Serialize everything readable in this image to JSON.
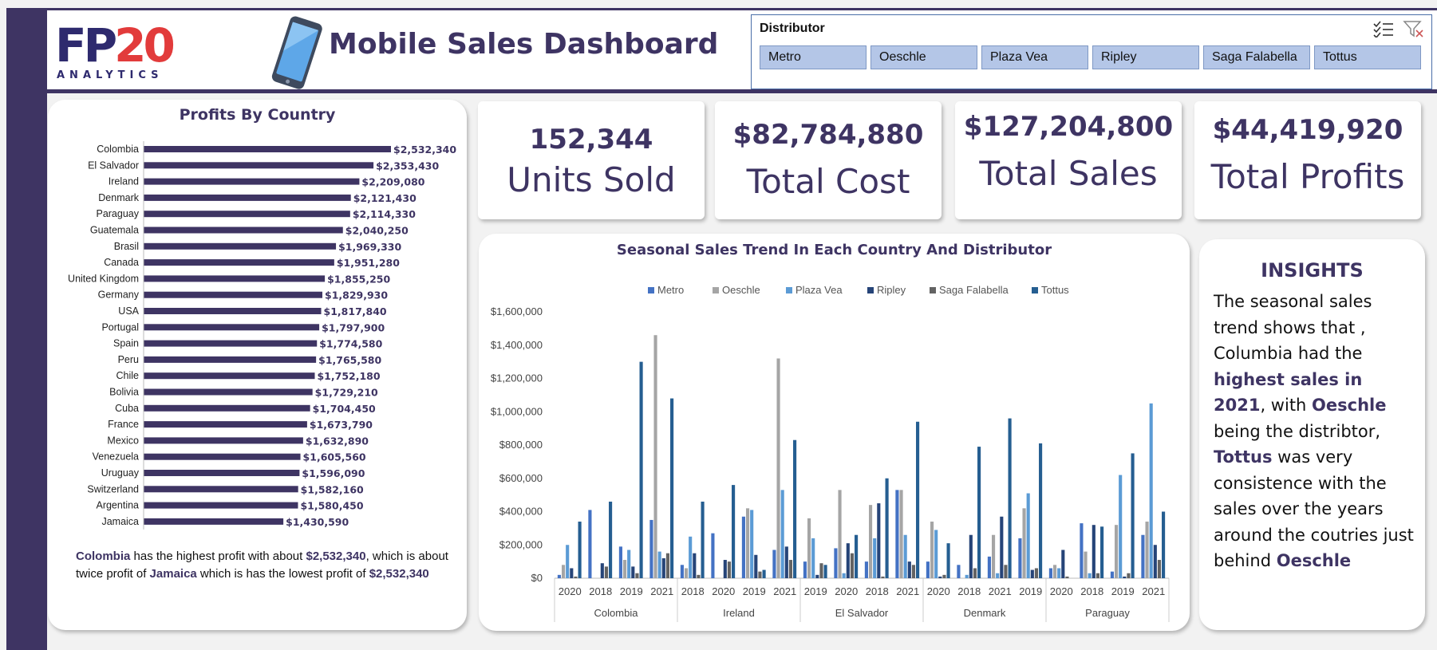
{
  "header": {
    "logo_main_a": "FP",
    "logo_main_b": "20",
    "logo_sub": "ANALYTICS",
    "title": "Mobile Sales Dashboard"
  },
  "slicer": {
    "title": "Distributor",
    "items": [
      "Metro",
      "Oeschle",
      "Plaza Vea",
      "Ripley",
      "Saga Falabella",
      "Tottus"
    ],
    "multi_select_icon": "multi-select-icon",
    "clear_filter_icon": "clear-filter-icon"
  },
  "kpis": [
    {
      "value": "152,344",
      "label": "Units Sold"
    },
    {
      "value": "$82,784,880",
      "label": "Total Cost"
    },
    {
      "value": "$127,204,800",
      "label": "Total Sales"
    },
    {
      "value": "$44,419,920",
      "label": "Total Profits"
    }
  ],
  "profits": {
    "note": {
      "t1": "Colombia",
      "t2": " has the highest profit with about ",
      "t3": "$2,532,340",
      "t4": ", which is about twice profit of ",
      "t5": "Jamaica",
      "t6": " which is has the lowest profit of ",
      "t7": "$2,532,340"
    }
  },
  "insights": {
    "title": "INSIGHTS",
    "t1": "The seasonal sales trend shows that , Columbia had the ",
    "t2": "highest sales in 2021",
    "t3": ", with ",
    "t4": "Oeschle",
    "t5": " being the distribtor, ",
    "t6": "Tottus",
    "t7": " was very consistence with the sales over the years around the coutries just behind ",
    "t8": "Oeschle"
  },
  "colors": {
    "accent": "#3e3463",
    "bar_profit": "#3e3463",
    "slicer_fill": "#b4c6e7"
  },
  "chart_data": [
    {
      "type": "bar",
      "orientation": "horizontal",
      "title": "Profits By Country",
      "xlim": [
        0,
        2532340
      ],
      "categories": [
        "Colombia",
        "El Salvador",
        "Ireland",
        "Denmark",
        "Paraguay",
        "Guatemala",
        "Brasil",
        "Canada",
        "United Kingdom",
        "Germany",
        "USA",
        "Portugal",
        "Spain",
        "Peru",
        "Chile",
        "Bolivia",
        "Cuba",
        "France",
        "Mexico",
        "Venezuela",
        "Uruguay",
        "Switzerland",
        "Argentina",
        "Jamaica"
      ],
      "values": [
        2532340,
        2353430,
        2209080,
        2121430,
        2114330,
        2040250,
        1969330,
        1951280,
        1855250,
        1829930,
        1817840,
        1797900,
        1774580,
        1765580,
        1752180,
        1729210,
        1704450,
        1673790,
        1632890,
        1605560,
        1596090,
        1582160,
        1580450,
        1430590
      ],
      "labels": [
        "$2,532,340",
        "$2,353,430",
        "$2,209,080",
        "$2,121,430",
        "$2,114,330",
        "$2,040,250",
        "$1,969,330",
        "$1,951,280",
        "$1,855,250",
        "$1,829,930",
        "$1,817,840",
        "$1,797,900",
        "$1,774,580",
        "$1,765,580",
        "$1,752,180",
        "$1,729,210",
        "$1,704,450",
        "$1,673,790",
        "$1,632,890",
        "$1,605,560",
        "$1,596,090",
        "$1,582,160",
        "$1,580,450",
        "$1,430,590"
      ],
      "grid": false
    },
    {
      "type": "bar",
      "title": "Seasonal Sales Trend In Each Country And Distributor",
      "ylim": [
        0,
        1600000
      ],
      "yticks": [
        "$0",
        "$200,000",
        "$400,000",
        "$600,000",
        "$800,000",
        "$1,000,000",
        "$1,200,000",
        "$1,400,000",
        "$1,600,000"
      ],
      "legend_position": "top",
      "groups": [
        {
          "name": "Colombia",
          "years": [
            "2020",
            "2018",
            "2019",
            "2021"
          ]
        },
        {
          "name": "Ireland",
          "years": [
            "2018",
            "2020",
            "2019",
            "2021"
          ]
        },
        {
          "name": "El Salvador",
          "years": [
            "2019",
            "2020",
            "2018",
            "2021"
          ]
        },
        {
          "name": "Denmark",
          "years": [
            "2020",
            "2018",
            "2021",
            "2019"
          ]
        },
        {
          "name": "Paraguay",
          "years": [
            "2020",
            "2018",
            "2019",
            "2021"
          ]
        }
      ],
      "series": [
        {
          "name": "Metro",
          "color": "#4472c4",
          "values": [
            20000,
            410000,
            190000,
            350000,
            80000,
            270000,
            370000,
            170000,
            100000,
            180000,
            100000,
            530000,
            100000,
            80000,
            130000,
            240000,
            60000,
            330000,
            40000,
            260000
          ]
        },
        {
          "name": "Oeschle",
          "color": "#a5a5a5",
          "values": [
            80000,
            0,
            110000,
            1460000,
            60000,
            0,
            420000,
            1320000,
            360000,
            530000,
            440000,
            530000,
            340000,
            0,
            260000,
            420000,
            80000,
            160000,
            320000,
            340000
          ]
        },
        {
          "name": "Plaza Vea",
          "color": "#5b9bd5",
          "values": [
            200000,
            0,
            170000,
            160000,
            250000,
            0,
            410000,
            530000,
            240000,
            30000,
            240000,
            260000,
            290000,
            20000,
            30000,
            510000,
            60000,
            30000,
            620000,
            1050000
          ]
        },
        {
          "name": "Ripley",
          "color": "#264478",
          "values": [
            60000,
            90000,
            70000,
            120000,
            150000,
            110000,
            140000,
            190000,
            20000,
            210000,
            450000,
            100000,
            10000,
            260000,
            370000,
            50000,
            170000,
            320000,
            10000,
            200000
          ]
        },
        {
          "name": "Saga Falabella",
          "color": "#636363",
          "values": [
            10000,
            70000,
            30000,
            150000,
            20000,
            100000,
            40000,
            110000,
            90000,
            150000,
            10000,
            80000,
            20000,
            60000,
            80000,
            60000,
            10000,
            30000,
            30000,
            110000
          ]
        },
        {
          "name": "Tottus",
          "color": "#255e91",
          "values": [
            340000,
            460000,
            1300000,
            1080000,
            460000,
            560000,
            50000,
            830000,
            80000,
            260000,
            600000,
            940000,
            210000,
            790000,
            960000,
            810000,
            0,
            310000,
            750000,
            400000
          ]
        }
      ]
    }
  ]
}
